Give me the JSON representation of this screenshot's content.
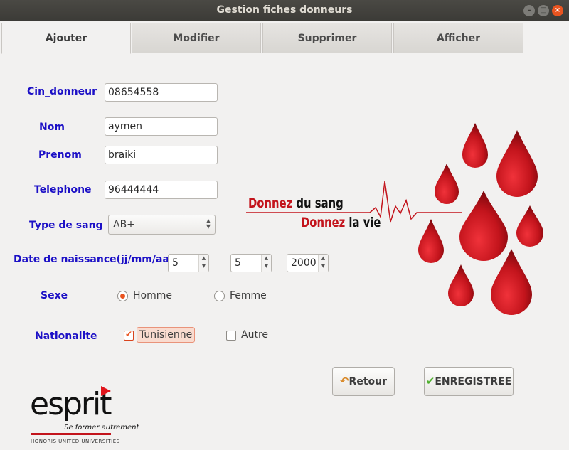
{
  "window": {
    "title": "Gestion fiches donneurs"
  },
  "tabs": [
    "Ajouter",
    "Modifier",
    "Supprimer",
    "Afficher"
  ],
  "form": {
    "cin_label": "Cin_donneur",
    "cin_value": "08654558",
    "nom_label": "Nom",
    "nom_value": "aymen",
    "prenom_label": "Prenom",
    "prenom_value": "braiki",
    "telephone_label": "Telephone",
    "telephone_value": "96444444",
    "type_label": "Type de sang",
    "type_value": "AB+",
    "date_label": "Date de naissance(jj/mm/aa)",
    "day": "5",
    "month": "5",
    "year": "2000",
    "sexe_label": "Sexe",
    "sexe_options": [
      "Homme",
      "Femme"
    ],
    "sexe_selected": "Homme",
    "nationalite_label": "Nationalite",
    "nationalite_options": [
      "Tunisienne",
      "Autre"
    ],
    "nationalite_checked": "Tunisienne"
  },
  "buttons": {
    "retour": "Retour",
    "enregistrer": "ENREGISTREE"
  },
  "banner": {
    "line1_red": "Donnez",
    "line1_black": "du sang",
    "line2_red": "Donnez",
    "line2_black": "la vie"
  },
  "logo": {
    "word": "esprit",
    "tagline": "Se former autrement",
    "footer": "HONORIS UNITED UNIVERSITIES"
  },
  "colors": {
    "label": "#1c10c6",
    "accent": "#e95420",
    "blood": "#c3141c"
  }
}
